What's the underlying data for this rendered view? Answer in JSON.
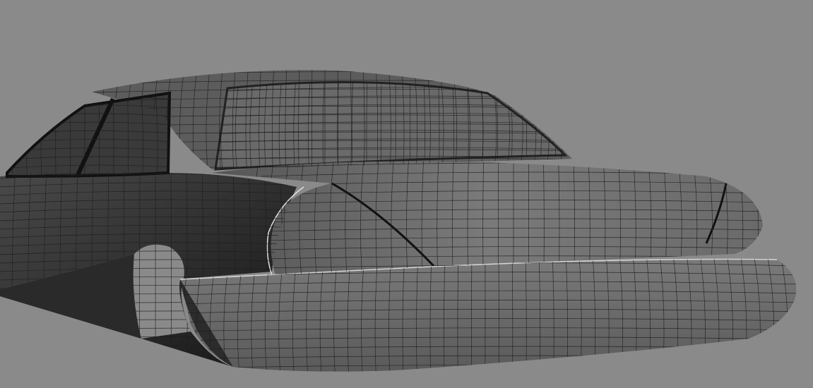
{
  "viewport": {
    "background_color": "#8a8a8a",
    "subject": "car-rear-wireframe-model",
    "colors": {
      "mesh_line": "#1c1c1c",
      "body_light": "#7a7a7a",
      "body_mid": "#5e5e5e",
      "body_dark": "#2a2a2a",
      "glass": "#3a3a3a",
      "bumper": "#6c6c6c"
    }
  }
}
